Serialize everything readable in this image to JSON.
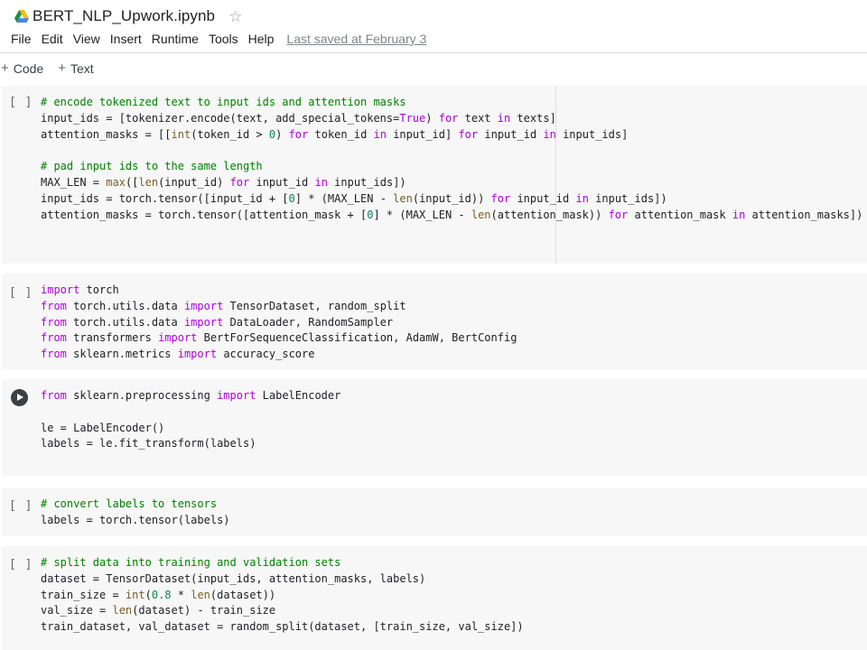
{
  "title": "BERT_NLP_Upwork.ipynb",
  "menu": [
    "File",
    "Edit",
    "View",
    "Insert",
    "Runtime",
    "Tools",
    "Help"
  ],
  "last_saved": "Last saved at February 3",
  "toolbar": {
    "code_label": "Code",
    "text_label": "Text"
  },
  "bracket": "[ ]",
  "cells": [
    {
      "lines": [
        "# encode tokenized text to input ids and attention masks",
        "input_ids = [tokenizer.encode(text, add_special_tokens=True) for text in texts]",
        "attention_masks = [[int(token_id > 0) for token_id in input_id] for input_id in input_ids]",
        "",
        "# pad input ids to the same length",
        "MAX_LEN = max([len(input_id) for input_id in input_ids])",
        "input_ids = torch.tensor([input_id + [0] * (MAX_LEN - len(input_id)) for input_id in input_ids])",
        "attention_masks = torch.tensor([attention_mask + [0] * (MAX_LEN - len(attention_mask)) for attention_mask in attention_masks])"
      ]
    },
    {
      "lines": [
        "import torch",
        "from torch.utils.data import TensorDataset, random_split",
        "from torch.utils.data import DataLoader, RandomSampler",
        "from transformers import BertForSequenceClassification, AdamW, BertConfig",
        "from sklearn.metrics import accuracy_score"
      ]
    },
    {
      "lines": [
        "from sklearn.preprocessing import LabelEncoder",
        "",
        "le = LabelEncoder()",
        "labels = le.fit_transform(labels)"
      ]
    },
    {
      "lines": [
        "# convert labels to tensors",
        "labels = torch.tensor(labels)"
      ]
    },
    {
      "lines": [
        "# split data into training and validation sets",
        "dataset = TensorDataset(input_ids, attention_masks, labels)",
        "train_size = int(0.8 * len(dataset))",
        "val_size = len(dataset) - train_size",
        "train_dataset, val_dataset = random_split(dataset, [train_size, val_size])"
      ]
    }
  ]
}
